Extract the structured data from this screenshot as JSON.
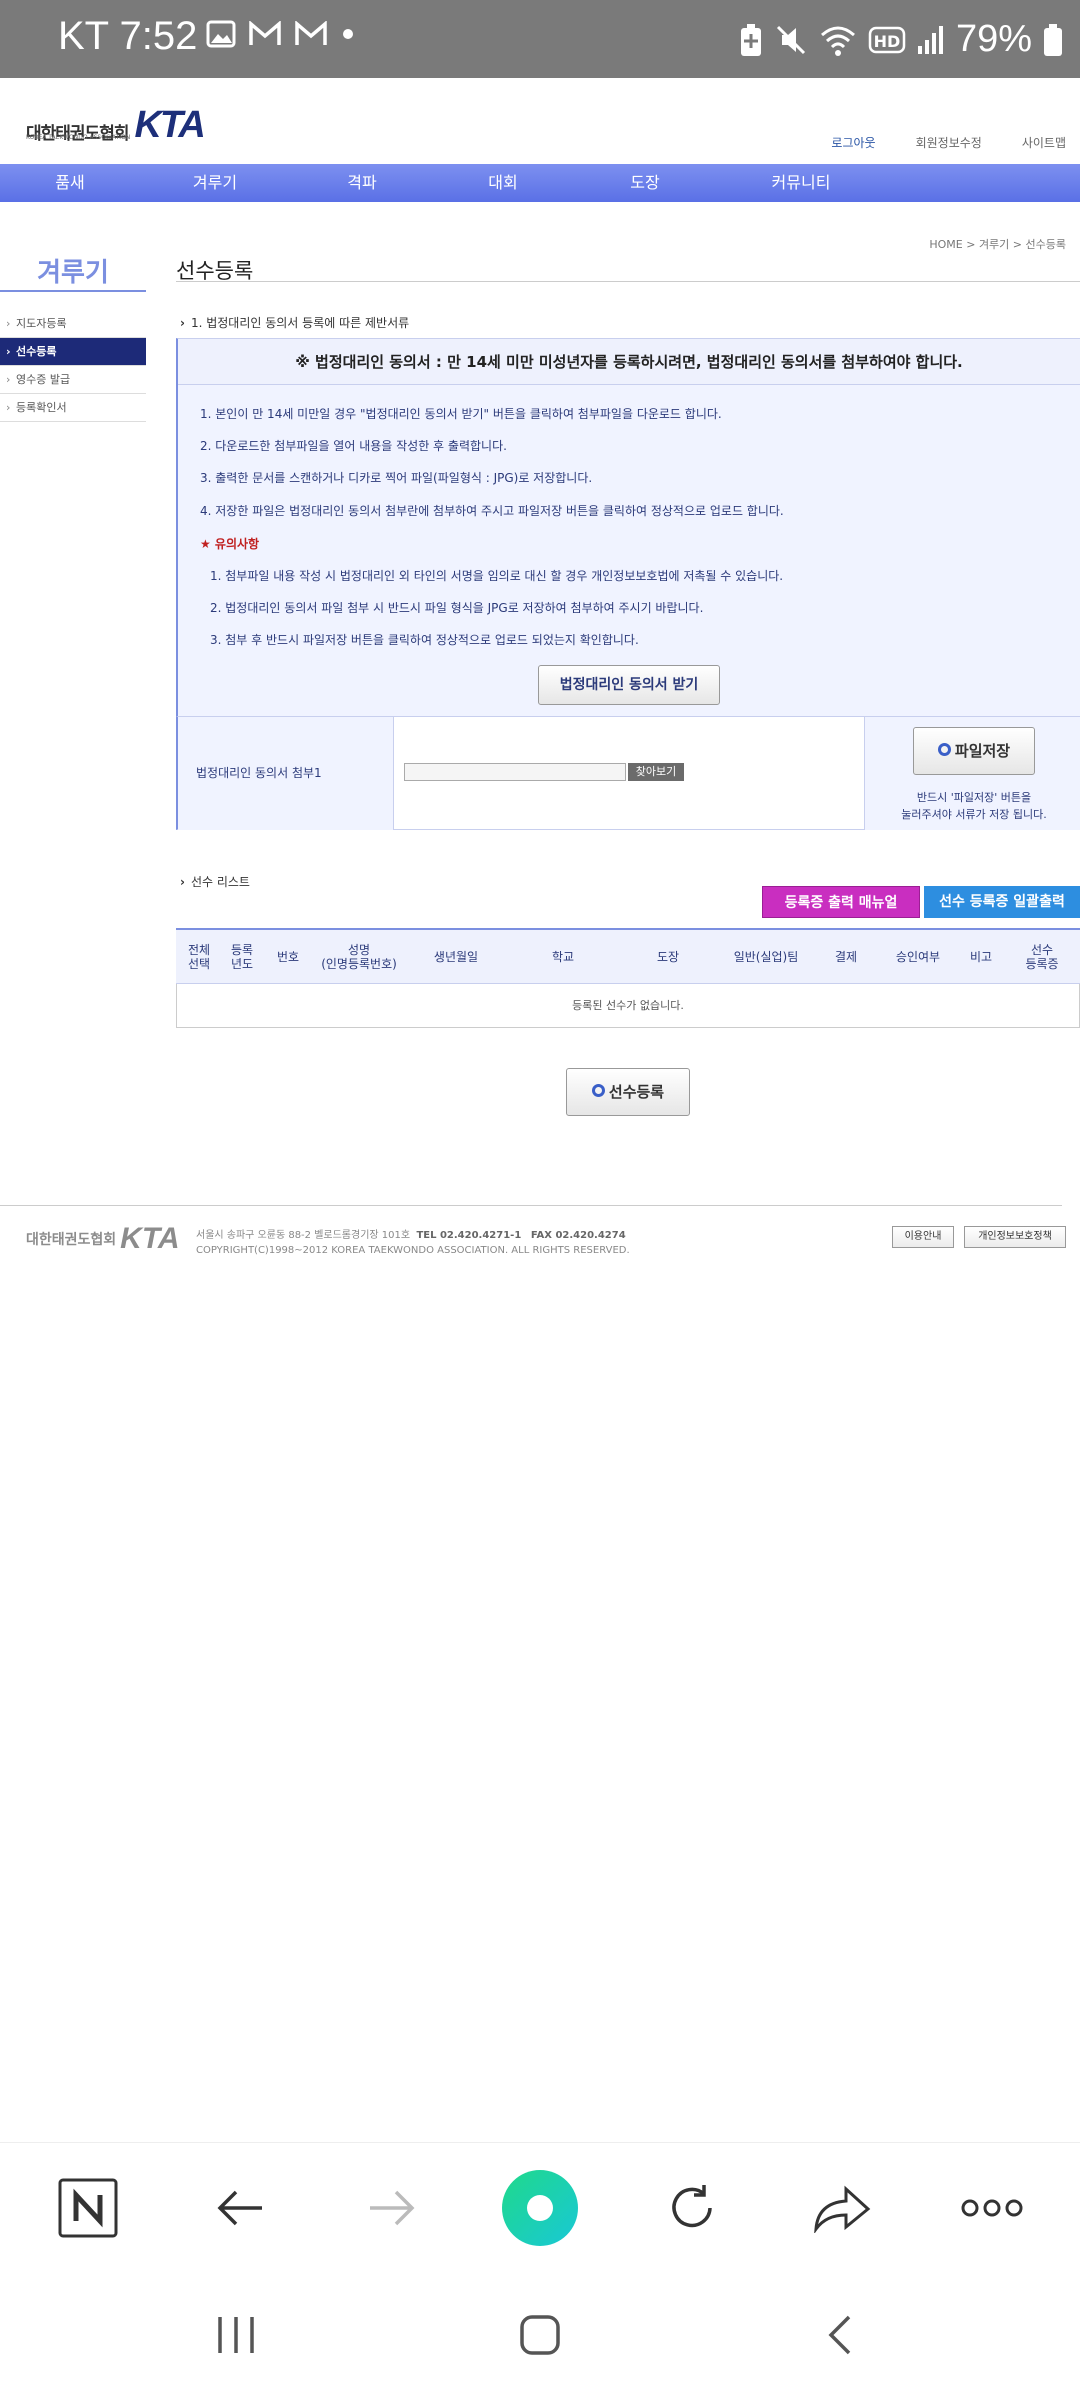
{
  "status_bar": {
    "carrier_time": "KT 7:52",
    "battery": "79%"
  },
  "header": {
    "logo_kr": "대한태권도협회",
    "logo_en": "KOREA TAEKWONDO ASSOCIATION",
    "logo_mark": "KTA",
    "top_links": [
      "로그아웃",
      "회원정보수정",
      "사이트맵"
    ]
  },
  "gnb": [
    "품새",
    "겨루기",
    "격파",
    "대회",
    "도장",
    "커뮤니티"
  ],
  "sidebar": {
    "title": "겨루기",
    "items": [
      {
        "label": "지도자등록"
      },
      {
        "label": "선수등록"
      },
      {
        "label": "영수증 발급"
      },
      {
        "label": "등록확인서"
      }
    ]
  },
  "page": {
    "title": "선수등록",
    "breadcrumb": "HOME > 겨루기 > 선수등록"
  },
  "section1": {
    "heading": "1. 법정대리인 동의서 등록에 따른 제반서류",
    "notice_head": "※ 법정대리인 동의서 : 만 14세 미만 미성년자를 등록하시려면, 법정대리인 동의서를 첨부하여야 합니다.",
    "steps": [
      "1. 본인이 만 14세 미만일 경우 \"법정대리인 동의서 받기\" 버튼을 클릭하여 첨부파일을 다운로드 합니다.",
      "2. 다운로드한 첨부파일을 열어 내용을 작성한 후 출력합니다.",
      "3. 출력한 문서를 스캔하거나 디카로 찍어 파일(파일형식 : JPG)로 저장합니다.",
      "4. 저장한 파일은 법정대리인 동의서 첨부란에 첨부하여 주시고 파일저장 버튼을 클릭하여 정상적으로 업로드 합니다."
    ],
    "warn_title": "★ 유의사항",
    "warnings": [
      "1. 첨부파일 내용 작성 시 법정대리인 외 타인의 서명을 임의로 대신 할 경우 개인정보보호법에 저촉될 수 있습니다.",
      "2. 법정대리인 동의서 파일 첨부 시 반드시 파일 형식을 JPG로 저장하여 첨부하여 주시기 바랍니다.",
      "3. 첨부 후 반드시 파일저장 버튼을 클릭하여 정상적으로 업로드 되었는지 확인합니다."
    ],
    "download_button": "법정대리인 동의서 받기",
    "attach_label": "법정대리인 동의서 첨부1",
    "file_value": "",
    "browse_button": "찾아보기",
    "save_button": "파일저장",
    "save_hint_1": "반드시 '파일저장' 버튼을",
    "save_hint_2": "눌러주셔야 서류가 저장 됩니다."
  },
  "section2": {
    "heading": "선수 리스트",
    "print_menu_button": "등록증 출력 매뉴얼",
    "bulk_print_button": "선수 등록증 일괄출력",
    "columns": [
      "전체\n선택",
      "등록\n년도",
      "번호",
      "성명\n(인명등록번호)",
      "생년월일",
      "학교",
      "도장",
      "일반(실업)팀",
      "결제",
      "승인여부",
      "비고",
      "선수\n등록증"
    ],
    "empty_message": "등록된 선수가 없습니다.",
    "register_button": "선수등록"
  },
  "footer": {
    "logo_kr": "대한태권도협회",
    "address": "서울시 송파구 오륜동 88-2 벨로드롬경기장 101호",
    "tel": "TEL 02.420.4271-1",
    "fax": "FAX 02.420.4274",
    "copyright": "COPYRIGHT(C)1998~2012 KOREA TAEKWONDO ASSOCIATION. ALL RIGHTS RESERVED.",
    "links": [
      "이용안내",
      "개인정보보호정책"
    ]
  },
  "browser_bar": {
    "icons": [
      "naver-n-icon",
      "back-arrow-icon",
      "forward-arrow-icon",
      "home-circle-icon",
      "refresh-icon",
      "share-icon",
      "more-icon"
    ],
    "accent": "#1fd9a8"
  }
}
